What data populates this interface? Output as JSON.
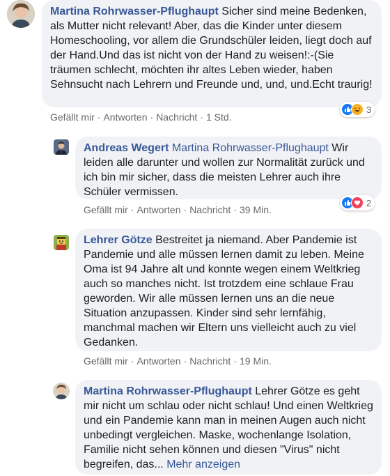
{
  "comments": [
    {
      "author": "Martina Rohrwasser-Pflughaupt",
      "text": " Sicher sind meine Bedenken, als Mutter nicht relevant! Aber, das die Kinder unter diesem Homeschooling, vor allem die Grundschüler leiden, liegt doch auf der Hand.Und das ist nicht von der Hand zu weisen!:-(Sie träumen schlecht, möchten ihr altes Leben wieder, haben Sehnsucht nach Lehrern und Freunde und, und, und.Echt traurig!",
      "actions": {
        "like": "Gefällt mir",
        "reply": "Antworten",
        "message": "Nachricht",
        "time": "1 Std."
      },
      "reaction_count": "3",
      "reaction_icons": [
        "like-icon",
        "haha-icon"
      ]
    },
    {
      "author": "Andreas Wegert",
      "mention": "Martina Rohrwasser-Pflughaupt",
      "text": " Wir leiden alle darunter und wollen zur Normalität zurück und ich bin mir sicher, dass die meisten Lehrer auch ihre Schüler vermissen.",
      "actions": {
        "like": "Gefällt mir",
        "reply": "Antworten",
        "message": "Nachricht",
        "time": "39 Min."
      },
      "reaction_count": "2",
      "reaction_icons": [
        "like-icon",
        "love-icon"
      ]
    },
    {
      "author": "Lehrer Götze",
      "text": " Bestreitet ja niemand. Aber Pandemie ist Pandemie und alle müssen lernen damit zu leben. Meine Oma ist 94 Jahre alt und konnte wegen einem Weltkrieg auch so manches nicht. Ist trotzdem eine schlaue Frau geworden. Wir alle müssen lernen uns an die neue Situation anzupassen. Kinder sind sehr lernfähig, manchmal machen wir Eltern uns vielleicht auch zu viel Gedanken.",
      "actions": {
        "like": "Gefällt mir",
        "reply": "Antworten",
        "message": "Nachricht",
        "time": "19 Min."
      }
    },
    {
      "author": "Martina Rohrwasser-Pflughaupt",
      "text": " Lehrer Götze es geht mir nicht um schlau oder nicht schlau! Und einen Weltkrieg und ein Pandemie kann man in meinen Augen auch nicht unbedingt vergleichen. Maske, wochenlange Isolation, Familie nicht sehen können und diesen \"Virus\" nicht begreifen, das...",
      "more": "Mehr anzeigen"
    }
  ],
  "colors": {
    "link": "#385898",
    "bubble": "#f0f2f5",
    "meta": "#65676b",
    "like": "#1877f2",
    "love": "#f33e58",
    "haha": "#f7b125"
  }
}
